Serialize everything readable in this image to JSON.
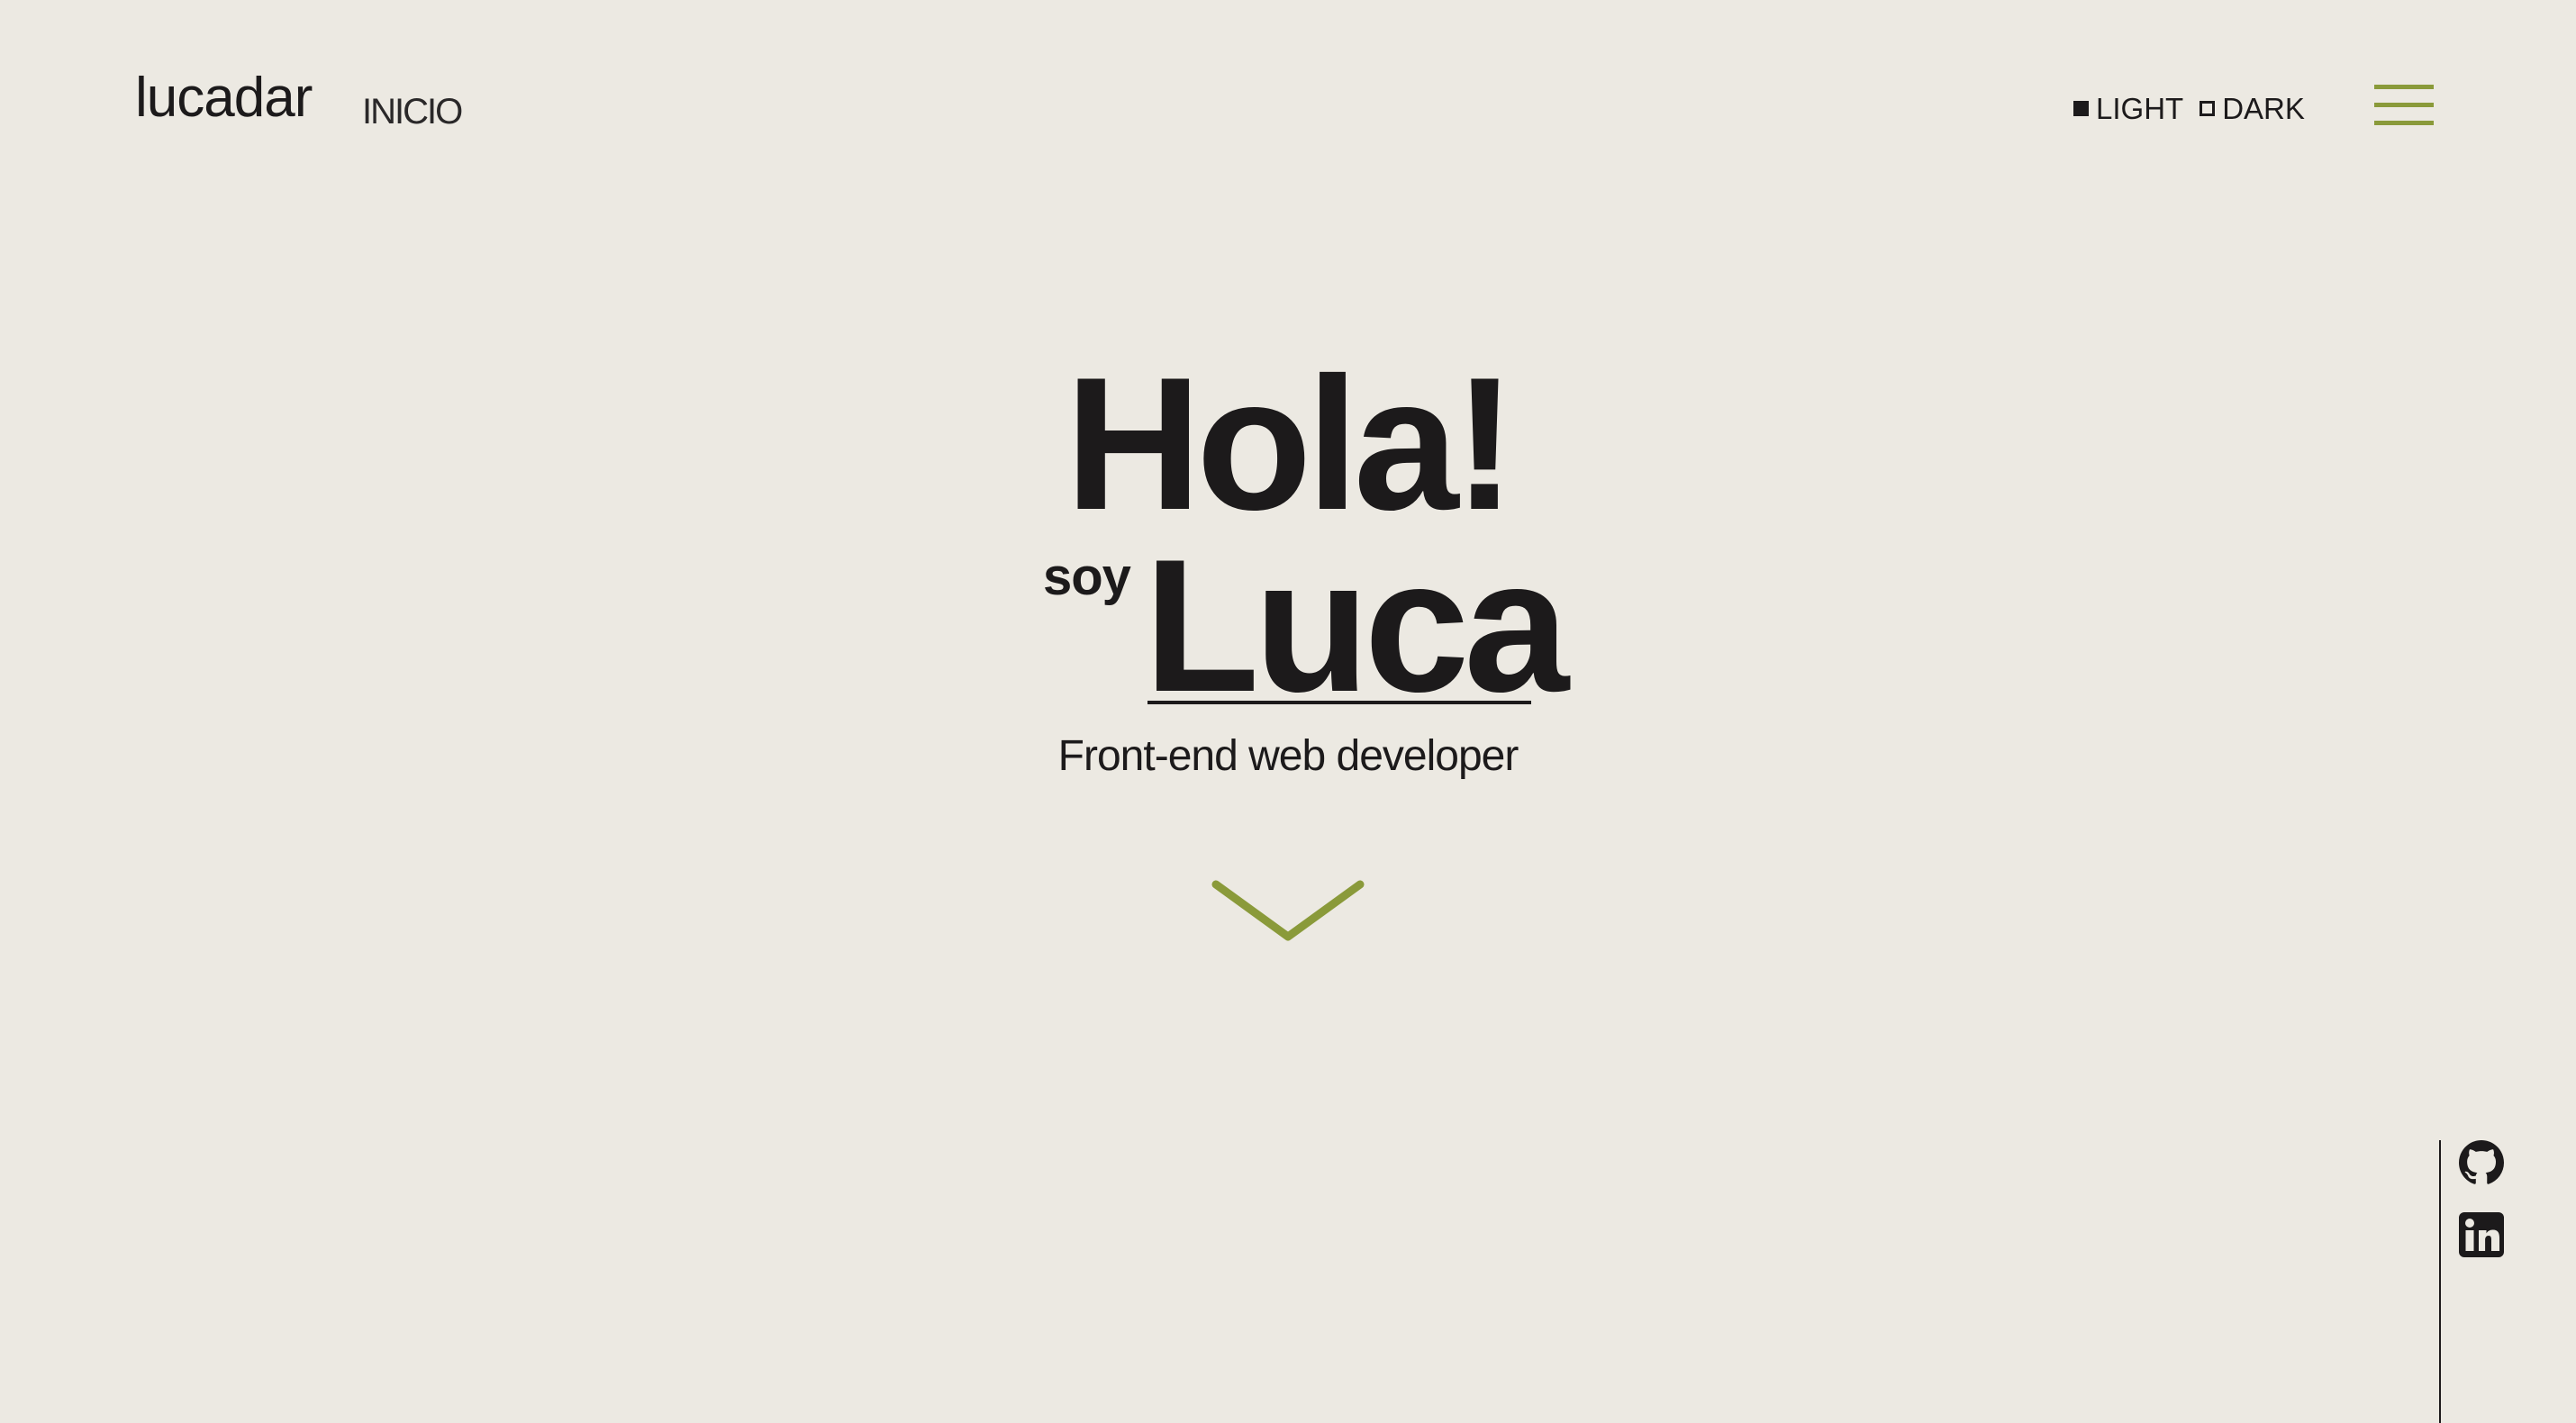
{
  "header": {
    "brand": "lucadar",
    "section": "INICIO",
    "theme": {
      "light_label": "LIGHT",
      "dark_label": "DARK",
      "selected": "LIGHT"
    },
    "menu_icon": "hamburger-icon"
  },
  "hero": {
    "greeting": "Hola!",
    "prefix": "soy",
    "name": "Luca",
    "role": "Front-end web developer",
    "scroll_icon": "chevron-down-icon"
  },
  "social": {
    "items": [
      {
        "icon": "github-icon"
      },
      {
        "icon": "linkedin-icon"
      }
    ]
  },
  "colors": {
    "background": "#ece9e2",
    "text": "#1c1a1b",
    "accent": "#8a9a3a"
  }
}
